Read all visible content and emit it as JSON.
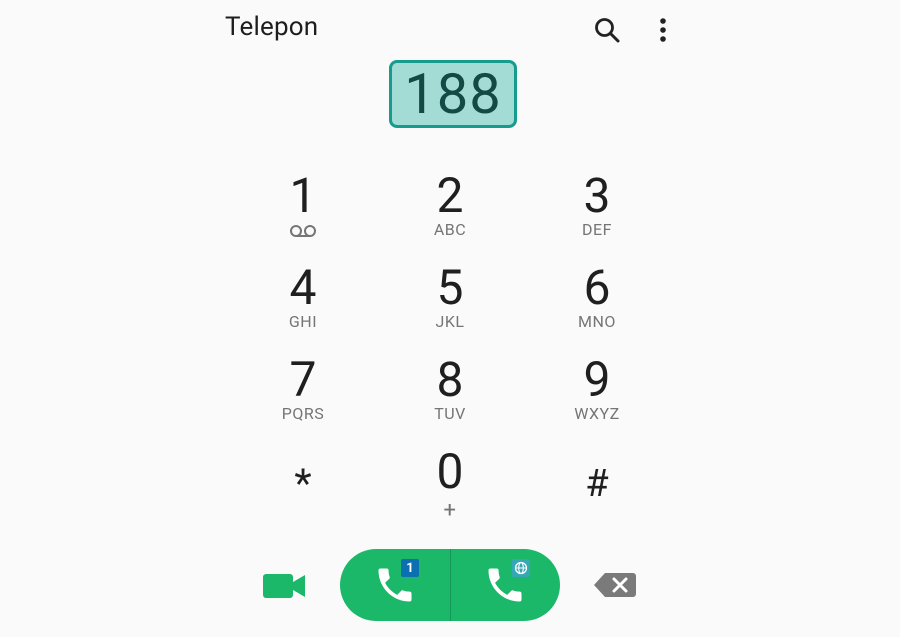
{
  "app": {
    "title": "Telepon"
  },
  "toolbar": {
    "search_icon": "search-icon",
    "more_icon": "more-vert-icon"
  },
  "dialed_number": "188",
  "keypad": {
    "keys": [
      {
        "digit": "1",
        "letters": "",
        "sub_icon": "voicemail-icon"
      },
      {
        "digit": "2",
        "letters": "ABC"
      },
      {
        "digit": "3",
        "letters": "DEF"
      },
      {
        "digit": "4",
        "letters": "GHI"
      },
      {
        "digit": "5",
        "letters": "JKL"
      },
      {
        "digit": "6",
        "letters": "MNO"
      },
      {
        "digit": "7",
        "letters": "PQRS"
      },
      {
        "digit": "8",
        "letters": "TUV"
      },
      {
        "digit": "9",
        "letters": "WXYZ"
      },
      {
        "digit": "*",
        "letters": ""
      },
      {
        "digit": "0",
        "letters": "+"
      },
      {
        "digit": "#",
        "letters": ""
      }
    ]
  },
  "actions": {
    "video_call_icon": "video-camera-icon",
    "call_sim1_badge": "1",
    "call_sim2_badge": "globe-icon",
    "backspace_icon": "backspace-icon"
  },
  "colors": {
    "accent_green": "#1bb86a",
    "highlight_fill": "#a3dcd5",
    "highlight_border": "#159c8e",
    "sim1_blue": "#0b6fb2"
  }
}
